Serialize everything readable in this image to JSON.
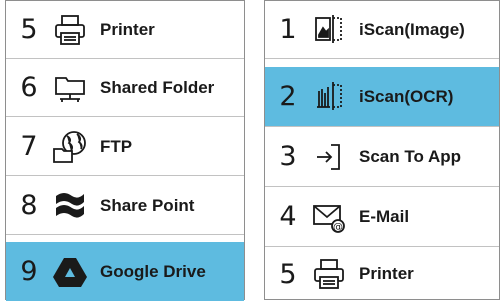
{
  "left_panel": {
    "items": [
      {
        "number": "5",
        "label": "Printer",
        "icon": "printer-icon"
      },
      {
        "number": "6",
        "label": "Shared Folder",
        "icon": "shared-folder-icon"
      },
      {
        "number": "7",
        "label": "FTP",
        "icon": "ftp-globe-icon"
      },
      {
        "number": "8",
        "label": "Share Point",
        "icon": "sharepoint-icon"
      },
      {
        "number": "9",
        "label": "Google Drive",
        "icon": "google-drive-icon",
        "selected": true
      }
    ]
  },
  "right_panel": {
    "items": [
      {
        "number": "1",
        "label": "iScan(Image)",
        "icon": "iscan-image-icon"
      },
      {
        "number": "2",
        "label": "iScan(OCR)",
        "icon": "iscan-ocr-icon",
        "selected": true
      },
      {
        "number": "3",
        "label": "Scan To App",
        "icon": "scan-to-app-icon"
      },
      {
        "number": "4",
        "label": "E-Mail",
        "icon": "email-icon"
      },
      {
        "number": "5",
        "label": "Printer",
        "icon": "printer-icon"
      }
    ]
  },
  "colors": {
    "selected_background": "#5ebbe0",
    "text": "#1a1a1a",
    "border": "#8e8e8e"
  }
}
